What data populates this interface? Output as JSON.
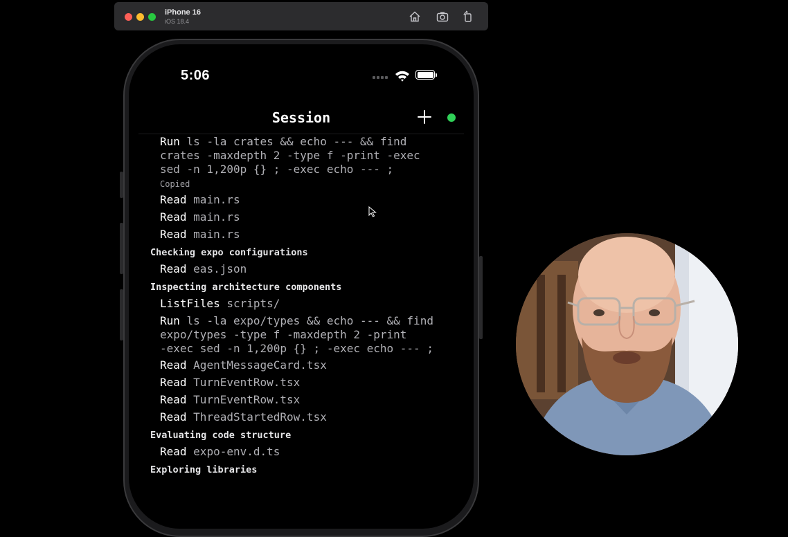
{
  "simulator": {
    "device": "iPhone 16",
    "os": "iOS 18.4",
    "buttons": [
      "home-icon",
      "screenshot-icon",
      "rotate-icon"
    ]
  },
  "status_bar": {
    "time": "5:06"
  },
  "nav": {
    "title": "Session",
    "add_icon": "plus-icon",
    "status_color": "#30d158"
  },
  "log": {
    "cmd1": {
      "verb": "Run",
      "line1": " ls -la crates && echo --- && find",
      "line2": "crates -maxdepth 2 -type f -print -exec",
      "line3": "sed -n 1,200p {} ; -exec echo --- ;"
    },
    "copied": "Copied",
    "reads_a": [
      {
        "verb": "Read",
        "arg": "main.rs"
      },
      {
        "verb": "Read",
        "arg": "main.rs"
      },
      {
        "verb": "Read",
        "arg": "main.rs"
      }
    ],
    "section1": "Checking expo configurations",
    "read_eas": {
      "verb": "Read",
      "arg": "eas.json"
    },
    "section2": "Inspecting architecture components",
    "listfiles": {
      "verb": "ListFiles",
      "arg": "scripts/"
    },
    "cmd2": {
      "verb": "Run",
      "line1": " ls -la expo/types && echo --- && find",
      "line2": "expo/types -type f -maxdepth 2 -print",
      "line3": "-exec sed -n 1,200p {} ; -exec echo --- ;"
    },
    "reads_b": [
      {
        "verb": "Read",
        "arg": "AgentMessageCard.tsx"
      },
      {
        "verb": "Read",
        "arg": "TurnEventRow.tsx"
      },
      {
        "verb": "Read",
        "arg": "TurnEventRow.tsx"
      },
      {
        "verb": "Read",
        "arg": "ThreadStartedRow.tsx"
      }
    ],
    "section3": "Evaluating code structure",
    "read_env": {
      "verb": "Read",
      "arg": "expo-env.d.ts"
    },
    "section4": "Exploring libraries"
  }
}
